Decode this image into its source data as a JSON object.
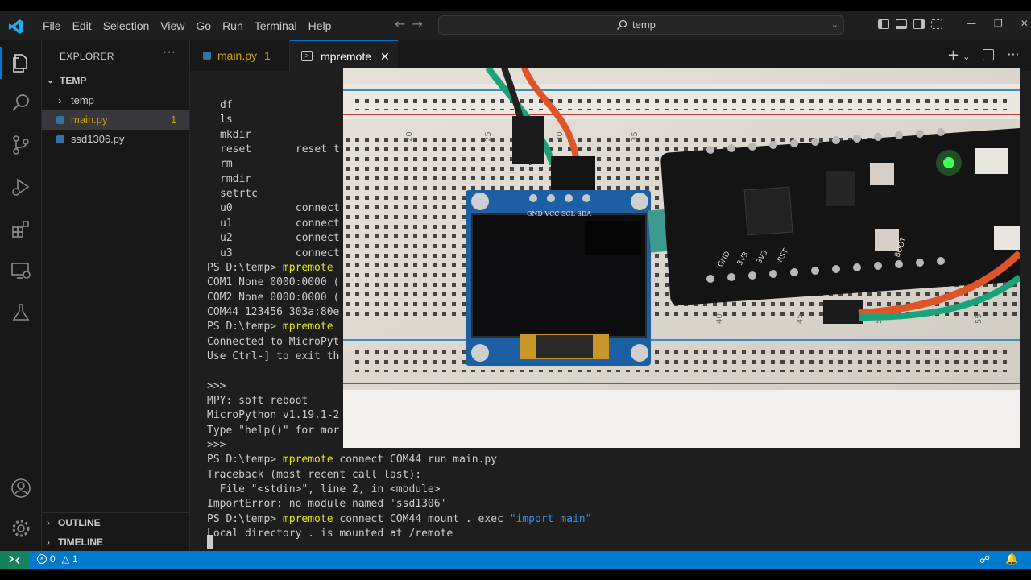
{
  "menu": [
    "File",
    "Edit",
    "Selection",
    "View",
    "Go",
    "Run",
    "Terminal",
    "Help"
  ],
  "command_center": {
    "title": "temp"
  },
  "explorer": {
    "header": "EXPLORER",
    "folder": "TEMP",
    "items": [
      {
        "label": "temp",
        "type": "folder"
      },
      {
        "label": "main.py",
        "type": "py",
        "badge": "1"
      },
      {
        "label": "ssd1306.py",
        "type": "py"
      }
    ],
    "outline": "OUTLINE",
    "timeline": "TIMELINE"
  },
  "tabs": [
    {
      "label": "main.py",
      "badge": "1"
    },
    {
      "label": "mpremote"
    }
  ],
  "terminal_lines": [
    {
      "parts": [
        {
          "t": "df"
        }
      ],
      "indent": true
    },
    {
      "parts": [
        {
          "t": "ls"
        }
      ],
      "indent": true
    },
    {
      "parts": [
        {
          "t": "mkdir"
        }
      ],
      "indent": true
    },
    {
      "parts": [
        {
          "t": "reset       reset t"
        }
      ],
      "indent": true
    },
    {
      "parts": [
        {
          "t": "rm"
        }
      ],
      "indent": true
    },
    {
      "parts": [
        {
          "t": "rmdir"
        }
      ],
      "indent": true
    },
    {
      "parts": [
        {
          "t": "setrtc"
        }
      ],
      "indent": true
    },
    {
      "parts": [
        {
          "t": "u0          connect"
        }
      ],
      "indent": true
    },
    {
      "parts": [
        {
          "t": "u1          connect"
        }
      ],
      "indent": true
    },
    {
      "parts": [
        {
          "t": "u2          connect"
        }
      ],
      "indent": true
    },
    {
      "parts": [
        {
          "t": "u3          connect"
        }
      ],
      "indent": true
    },
    {
      "parts": [
        {
          "t": "PS D:\\temp> "
        },
        {
          "t": "mpremote",
          "c": "y"
        }
      ]
    },
    {
      "parts": [
        {
          "t": "COM1 None 0000:0000 ("
        }
      ]
    },
    {
      "parts": [
        {
          "t": "COM2 None 0000:0000 ("
        }
      ]
    },
    {
      "parts": [
        {
          "t": "COM44 123456 303a:80e"
        }
      ]
    },
    {
      "parts": [
        {
          "t": "PS D:\\temp> "
        },
        {
          "t": "mpremote",
          "c": "y"
        }
      ]
    },
    {
      "parts": [
        {
          "t": "Connected to MicroPyt"
        }
      ]
    },
    {
      "parts": [
        {
          "t": "Use Ctrl-] to exit th"
        }
      ]
    },
    {
      "parts": [
        {
          "t": ""
        }
      ]
    },
    {
      "parts": [
        {
          "t": ">>>"
        }
      ]
    },
    {
      "parts": [
        {
          "t": "MPY: soft reboot"
        }
      ]
    },
    {
      "parts": [
        {
          "t": "MicroPython v1.19.1-2"
        }
      ]
    },
    {
      "parts": [
        {
          "t": "Type \"help()\" for mor"
        }
      ]
    },
    {
      "parts": [
        {
          "t": ">>>"
        }
      ]
    },
    {
      "parts": [
        {
          "t": "PS D:\\temp> "
        },
        {
          "t": "mpremote",
          "c": "y"
        },
        {
          "t": " connect COM44 run main.py"
        }
      ]
    },
    {
      "parts": [
        {
          "t": "Traceback (most recent call last):"
        }
      ]
    },
    {
      "parts": [
        {
          "t": "  File \"<stdin>\", line 2, in <module>"
        }
      ]
    },
    {
      "parts": [
        {
          "t": "ImportError: no module named 'ssd1306'"
        }
      ]
    },
    {
      "parts": [
        {
          "t": "PS D:\\temp> "
        },
        {
          "t": "mpremote",
          "c": "y"
        },
        {
          "t": " connect COM44 mount . exec "
        },
        {
          "t": "\"import main\"",
          "c": "b"
        }
      ]
    },
    {
      "parts": [
        {
          "t": "Local directory . is mounted at /remote"
        }
      ]
    }
  ],
  "status": {
    "errors": "0",
    "warnings": "1"
  },
  "photo": {
    "oled_pins": "GND VCC SCL SDA",
    "ruler_numbers": [
      "20",
      "25",
      "30",
      "35",
      "40",
      "45",
      "50",
      "55"
    ],
    "board_labels": [
      "GND",
      "3V3",
      "3V3",
      "RST",
      "BOOT"
    ]
  },
  "colors": {
    "accent": "#007acc",
    "remote": "#16825d",
    "warning": "#cca700",
    "keyword": "#e5e510",
    "string": "#3b8eea"
  }
}
